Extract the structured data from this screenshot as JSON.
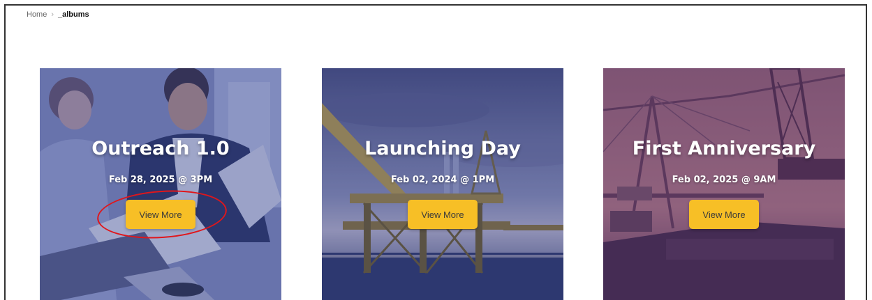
{
  "breadcrumb": {
    "home": "Home",
    "separator": "›",
    "current": "_albums"
  },
  "cards": [
    {
      "title": "Outreach 1.0",
      "date": "Feb 28, 2025 @ 3PM",
      "button_label": "View More"
    },
    {
      "title": "Launching Day",
      "date": "Feb 02, 2024 @ 1PM",
      "button_label": "View More"
    },
    {
      "title": "First Anniversary",
      "date": "Feb 02, 2025 @ 9AM",
      "button_label": "View More"
    }
  ],
  "colors": {
    "button": "#f7bf26",
    "annotation": "#e0161b",
    "overlay_blue": "#2c3a86",
    "overlay_purple": "#5a3466"
  }
}
